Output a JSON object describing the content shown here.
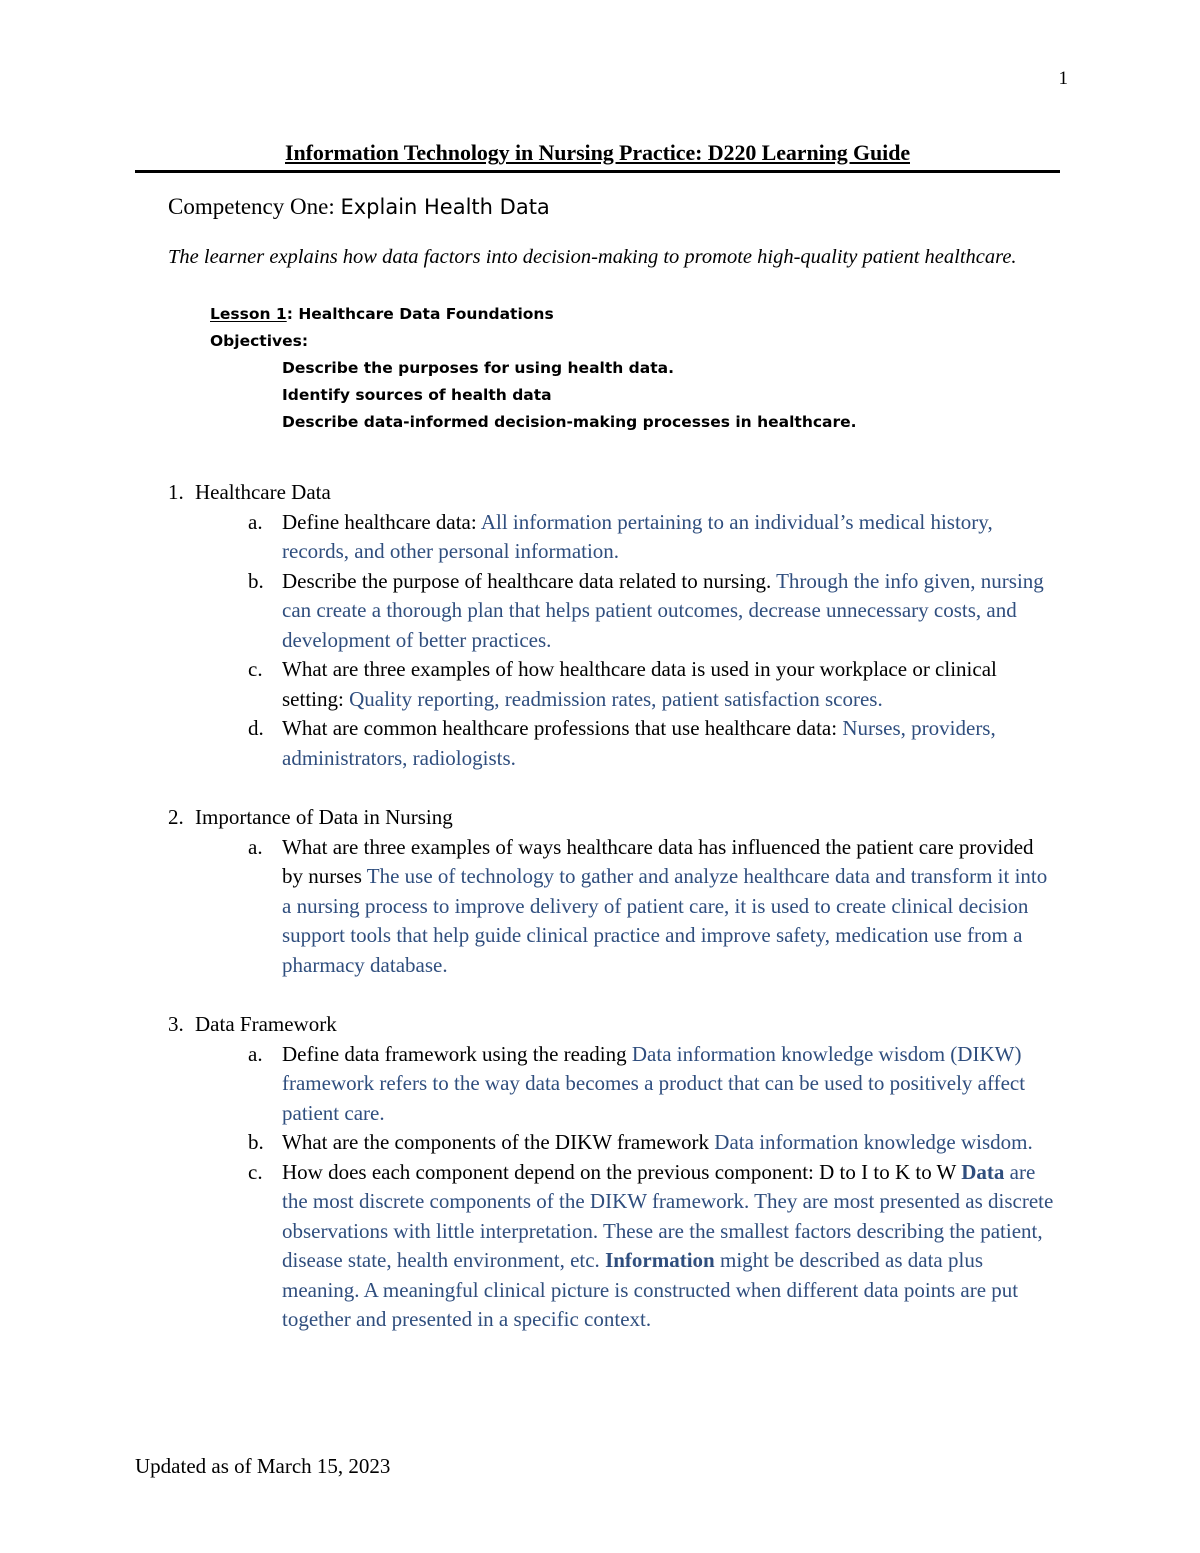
{
  "page": {
    "number": "1",
    "header_title": "Information Technology in Nursing Practice: D220 Learning Guide",
    "footer": "Updated as of March 15, 2023"
  },
  "competency": {
    "label": "Competency One:",
    "value": "Explain Health Data"
  },
  "learner_statement": "The learner explains how data factors into decision-making to promote high-quality patient healthcare.",
  "objectives": {
    "lesson_label": "Lesson 1",
    "lesson_title": ": Healthcare Data Foundations",
    "heading": "Objectives:",
    "items": [
      "Describe the purposes for using health data.",
      "Identify sources of health data",
      "Describe data-informed decision-making processes in healthcare."
    ]
  },
  "sections": [
    {
      "number": "1.",
      "title": "Healthcare Data",
      "items": [
        {
          "marker": "a.",
          "question": "Define healthcare data: ",
          "answer": "All information pertaining to an individual’s medical history, records, and other personal information."
        },
        {
          "marker": "b.",
          "question": "Describe the purpose of healthcare data related to nursing. ",
          "answer": "Through the info given, nursing can create a thorough plan that helps patient outcomes, decrease unnecessary costs, and development of better practices."
        },
        {
          "marker": "c.",
          "question": "What are three examples of how healthcare data is used in your workplace or clinical setting: ",
          "answer": "Quality reporting, readmission rates, patient satisfaction scores."
        },
        {
          "marker": "d.",
          "question": "What are common healthcare professions that use healthcare data: ",
          "answer": "Nurses, providers, administrators, radiologists."
        }
      ]
    },
    {
      "number": "2.",
      "title": "Importance of Data in Nursing",
      "items": [
        {
          "marker": "a.",
          "question": "What are three examples of ways healthcare data has influenced the patient care provided by nurses ",
          "answer": "The use of technology to gather and analyze healthcare data and transform it into a nursing process to improve delivery of patient care, it is used to create clinical decision support tools that help guide clinical practice and improve safety, medication use from a pharmacy database."
        }
      ]
    },
    {
      "number": "3.",
      "title": "Data Framework",
      "items": [
        {
          "marker": "a.",
          "question": "Define data framework using the reading ",
          "answer": "Data information knowledge wisdom (DIKW) framework refers to the way data becomes a product that can be used to positively affect patient care."
        },
        {
          "marker": "b.",
          "question": "What are the components of the DIKW framework ",
          "answer": "Data information knowledge wisdom."
        },
        {
          "marker": "c.",
          "question": "How does each component depend on the previous component: D to I to K to W ",
          "answer_term_1": "Data",
          "answer_part_1": " are the most discrete components of the DIKW framework. They are most presented as discrete observations with little interpretation. These are the smallest factors describing the patient, disease state, health environment, etc. ",
          "answer_term_2": "Information",
          "answer_part_2": " might be described as data plus meaning. A meaningful clinical picture is constructed when different data points are put together and presented in a specific context."
        }
      ]
    }
  ],
  "colors": {
    "answer_blue": "#2F4E7E",
    "objective_red": "#FF0000",
    "text_black": "#000000"
  }
}
